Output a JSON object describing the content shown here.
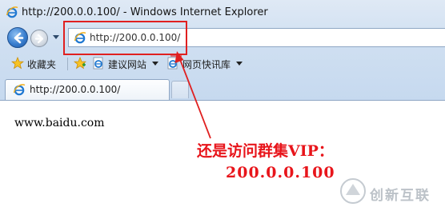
{
  "window": {
    "title": "http://200.0.0.100/ - Windows Internet Explorer"
  },
  "address_bar": {
    "url": "http://200.0.0.100/"
  },
  "favorites_bar": {
    "favorites_label": "收藏夹",
    "items": [
      {
        "label": "建议网站"
      },
      {
        "label": "网页快讯库"
      }
    ]
  },
  "tabs": [
    {
      "label": "http://200.0.0.100/"
    }
  ],
  "page": {
    "body_text": "www.baidu.com"
  },
  "annotation": {
    "line1": "还是访问群集VIP：",
    "line2": "200.0.0.100",
    "color": "#e8151b"
  },
  "watermark": {
    "text": "创新互联"
  }
}
